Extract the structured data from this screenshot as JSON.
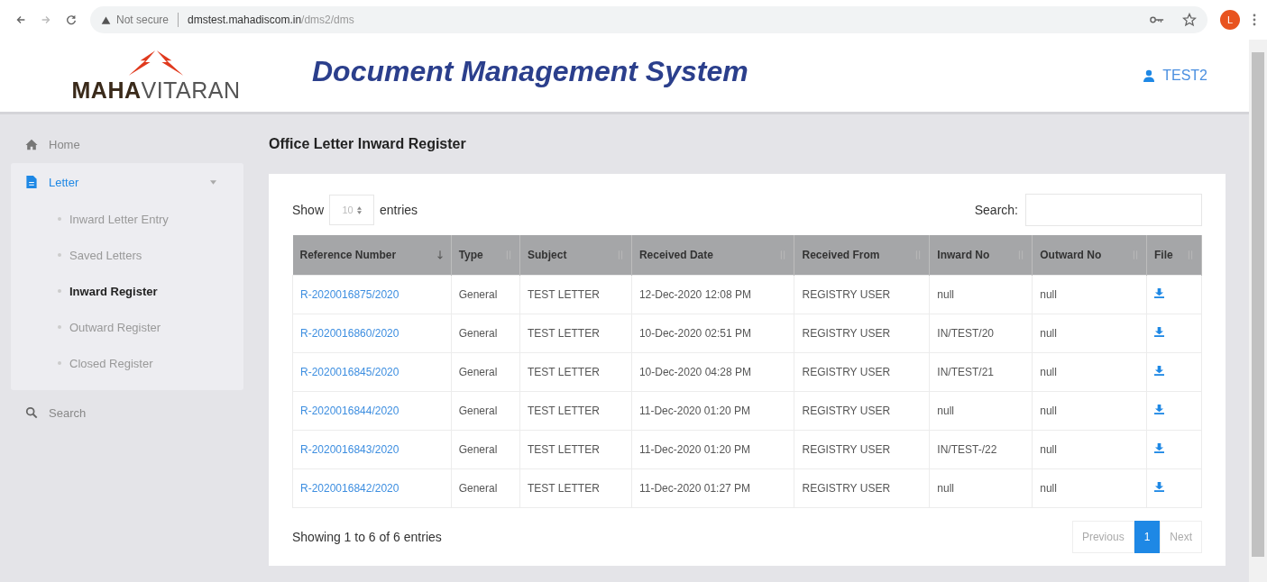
{
  "browser": {
    "security": "Not secure",
    "url_host": "dmstest.mahadiscom.in",
    "url_path": "/dms2/dms",
    "profile_initial": "L"
  },
  "header": {
    "logo_bold": "MAHA",
    "logo_light": "VITARAN",
    "title": "Document Management System",
    "user": "TEST2"
  },
  "sidebar": {
    "items": [
      {
        "label": "Home",
        "kind": "home",
        "selected": false
      },
      {
        "label": "Letter",
        "kind": "file",
        "selected": true,
        "expanded": true,
        "children": [
          {
            "label": "Inward Letter Entry",
            "selected": false
          },
          {
            "label": "Saved Letters",
            "selected": false
          },
          {
            "label": "Inward Register",
            "selected": true
          },
          {
            "label": "Outward Register",
            "selected": false
          },
          {
            "label": "Closed Register",
            "selected": false
          }
        ]
      },
      {
        "label": "Search",
        "kind": "search",
        "selected": false
      }
    ]
  },
  "page_title": "Office Letter Inward Register",
  "table_controls": {
    "show_label": "Show",
    "entries_value": "10",
    "entries_label": "entries",
    "search_label": "Search:"
  },
  "table": {
    "columns": [
      {
        "label": "Reference Number",
        "sorted": true
      },
      {
        "label": "Type",
        "sorted": false
      },
      {
        "label": "Subject",
        "sorted": false
      },
      {
        "label": "Received Date",
        "sorted": false
      },
      {
        "label": "Received From",
        "sorted": false
      },
      {
        "label": "Inward No",
        "sorted": false
      },
      {
        "label": "Outward No",
        "sorted": false
      },
      {
        "label": "File",
        "sorted": false
      }
    ],
    "rows": [
      [
        "R-2020016875/2020",
        "General",
        "TEST LETTER",
        "12-Dec-2020 12:08 PM",
        "REGISTRY USER",
        "null",
        "null"
      ],
      [
        "R-2020016860/2020",
        "General",
        "TEST LETTER",
        "10-Dec-2020 02:51 PM",
        "REGISTRY USER",
        "IN/TEST/20",
        "null"
      ],
      [
        "R-2020016845/2020",
        "General",
        "TEST LETTER",
        "10-Dec-2020 04:28 PM",
        "REGISTRY USER",
        "IN/TEST/21",
        "null"
      ],
      [
        "R-2020016844/2020",
        "General",
        "TEST LETTER",
        "11-Dec-2020 01:20 PM",
        "REGISTRY USER",
        "null",
        "null"
      ],
      [
        "R-2020016843/2020",
        "General",
        "TEST LETTER",
        "11-Dec-2020 01:20 PM",
        "REGISTRY USER",
        "IN/TEST-/22",
        "null"
      ],
      [
        "R-2020016842/2020",
        "General",
        "TEST LETTER",
        "11-Dec-2020 01:27 PM",
        "REGISTRY USER",
        "null",
        "null"
      ]
    ]
  },
  "footer": {
    "info": "Showing 1 to 6 of 6 entries",
    "pages": [
      {
        "label": "Previous",
        "selected": false
      },
      {
        "label": "1",
        "selected": true
      },
      {
        "label": "Next",
        "selected": false
      }
    ]
  }
}
